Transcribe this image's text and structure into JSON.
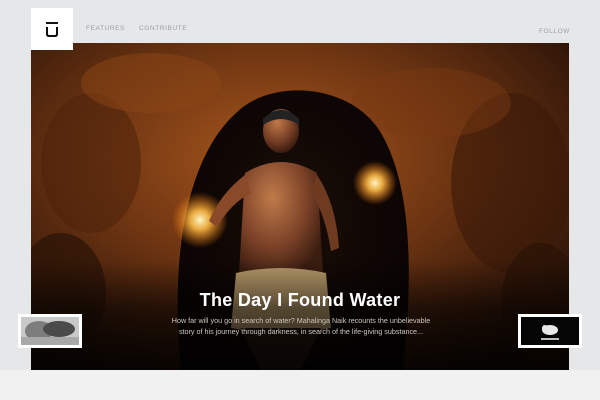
{
  "header": {
    "logo_icon": "u-block-logo-icon",
    "nav": [
      {
        "label": "FEATURES"
      },
      {
        "label": "CONTRIBUTE"
      }
    ],
    "follow_label": "FOLLOW"
  },
  "hero": {
    "title": "The Day I Found Water",
    "description": "How far will you go in search of water? Mahalinga Naik recounts the unbelievable story of his journey through darkness, in search of the life-giving substance..."
  },
  "carousel": {
    "prev_thumb_icon": "previous-story-thumbnail",
    "next_thumb_icon": "next-story-thumbnail"
  },
  "colors": {
    "background": "#e6e7e9",
    "nav_text": "#9a9ea3",
    "hero_title": "#ffffff"
  }
}
